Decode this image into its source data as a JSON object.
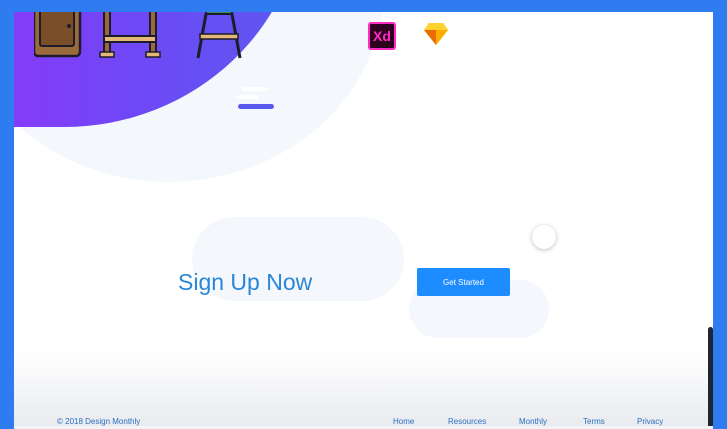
{
  "tools": {
    "xd_label": "Xd",
    "xd_icon": "adobe-xd-icon",
    "sketch_icon": "sketch-diamond-icon"
  },
  "signup": {
    "title": "Sign Up Now",
    "cta_label": "Get Started"
  },
  "footer": {
    "copyright": "© 2018 Design Monthly",
    "links": [
      "Home",
      "Resources",
      "Monthly",
      "Terms",
      "Privacy"
    ]
  },
  "colors": {
    "frame": "#2f7bf0",
    "hero_gradient_start": "#9a2fff",
    "hero_gradient_end": "#5a5af0",
    "cta": "#1c8cff",
    "title": "#2a86d6",
    "footer_text": "#2a6fc0"
  }
}
